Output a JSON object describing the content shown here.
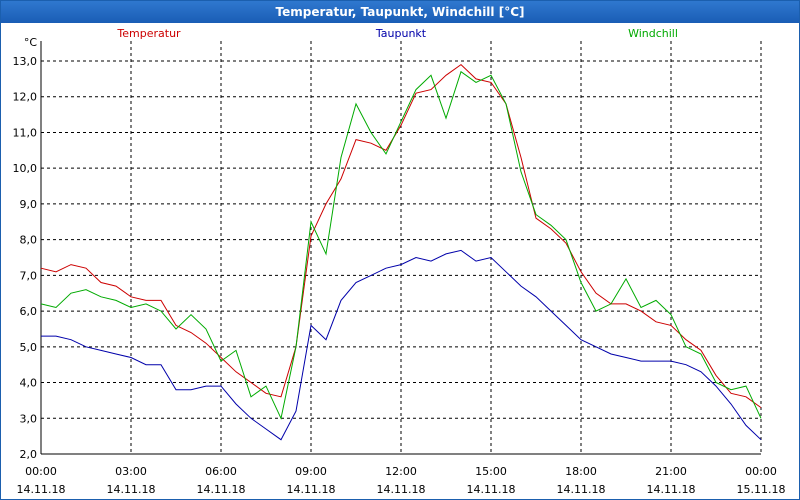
{
  "title": "Temperatur, Taupunkt, Windchill [°C]",
  "chart_data": {
    "type": "line",
    "title": "Temperatur, Taupunkt, Windchill [°C]",
    "ylabel": "°C",
    "ylim": [
      2.0,
      13.0
    ],
    "yticks": [
      "2,0",
      "3,0",
      "4,0",
      "5,0",
      "6,0",
      "7,0",
      "8,0",
      "9,0",
      "10,0",
      "11,0",
      "12,0",
      "13,0"
    ],
    "xlim": [
      0,
      24
    ],
    "xticks": [
      {
        "time": "00:00",
        "date": "14.11.18"
      },
      {
        "time": "03:00",
        "date": "14.11.18"
      },
      {
        "time": "06:00",
        "date": "14.11.18"
      },
      {
        "time": "09:00",
        "date": "14.11.18"
      },
      {
        "time": "12:00",
        "date": "14.11.18"
      },
      {
        "time": "15:00",
        "date": "14.11.18"
      },
      {
        "time": "18:00",
        "date": "14.11.18"
      },
      {
        "time": "21:00",
        "date": "14.11.18"
      },
      {
        "time": "00:00",
        "date": "15.11.18"
      }
    ],
    "grid": true,
    "x": [
      0,
      0.5,
      1,
      1.5,
      2,
      2.5,
      3,
      3.5,
      4,
      4.5,
      5,
      5.5,
      6,
      6.5,
      7,
      7.5,
      8,
      8.5,
      9,
      9.5,
      10,
      10.5,
      11,
      11.5,
      12,
      12.5,
      13,
      13.5,
      14,
      14.5,
      15,
      15.5,
      16,
      16.5,
      17,
      17.5,
      18,
      18.5,
      19,
      19.5,
      20,
      20.5,
      21,
      21.5,
      22,
      22.5,
      23,
      23.5,
      24
    ],
    "series": [
      {
        "name": "Temperatur",
        "color": "#cc0000",
        "values": [
          7.2,
          7.1,
          7.3,
          7.2,
          6.8,
          6.7,
          6.4,
          6.3,
          6.3,
          5.6,
          5.4,
          5.1,
          4.7,
          4.3,
          4.0,
          3.7,
          3.6,
          5.0,
          8.1,
          9.0,
          9.7,
          10.8,
          10.7,
          10.5,
          11.2,
          12.1,
          12.2,
          12.6,
          12.9,
          12.5,
          12.4,
          11.8,
          10.3,
          8.6,
          8.3,
          7.9,
          7.1,
          6.5,
          6.2,
          6.2,
          6.0,
          5.7,
          5.6,
          5.2,
          4.9,
          4.2,
          3.7,
          3.6,
          3.3
        ]
      },
      {
        "name": "Taupunkt",
        "color": "#0000aa",
        "values": [
          5.3,
          5.3,
          5.2,
          5.0,
          4.9,
          4.8,
          4.7,
          4.5,
          4.5,
          3.8,
          3.8,
          3.9,
          3.9,
          3.4,
          3.0,
          2.7,
          2.4,
          3.2,
          5.6,
          5.2,
          6.3,
          6.8,
          7.0,
          7.2,
          7.3,
          7.5,
          7.4,
          7.6,
          7.7,
          7.4,
          7.5,
          7.1,
          6.7,
          6.4,
          6.0,
          5.6,
          5.2,
          5.0,
          4.8,
          4.7,
          4.6,
          4.6,
          4.6,
          4.5,
          4.3,
          3.9,
          3.4,
          2.8,
          2.4
        ]
      },
      {
        "name": "Windchill",
        "color": "#00aa00",
        "values": [
          6.2,
          6.1,
          6.5,
          6.6,
          6.4,
          6.3,
          6.1,
          6.2,
          6.0,
          5.5,
          5.9,
          5.5,
          4.6,
          4.9,
          3.6,
          3.9,
          3.0,
          5.0,
          8.5,
          7.6,
          10.3,
          11.8,
          11.0,
          10.4,
          11.3,
          12.2,
          12.6,
          11.4,
          12.7,
          12.4,
          12.6,
          11.8,
          9.9,
          8.7,
          8.4,
          8.0,
          6.8,
          6.0,
          6.2,
          6.9,
          6.1,
          6.3,
          5.9,
          5.0,
          4.8,
          4.0,
          3.8,
          3.9,
          3.0
        ]
      }
    ]
  }
}
